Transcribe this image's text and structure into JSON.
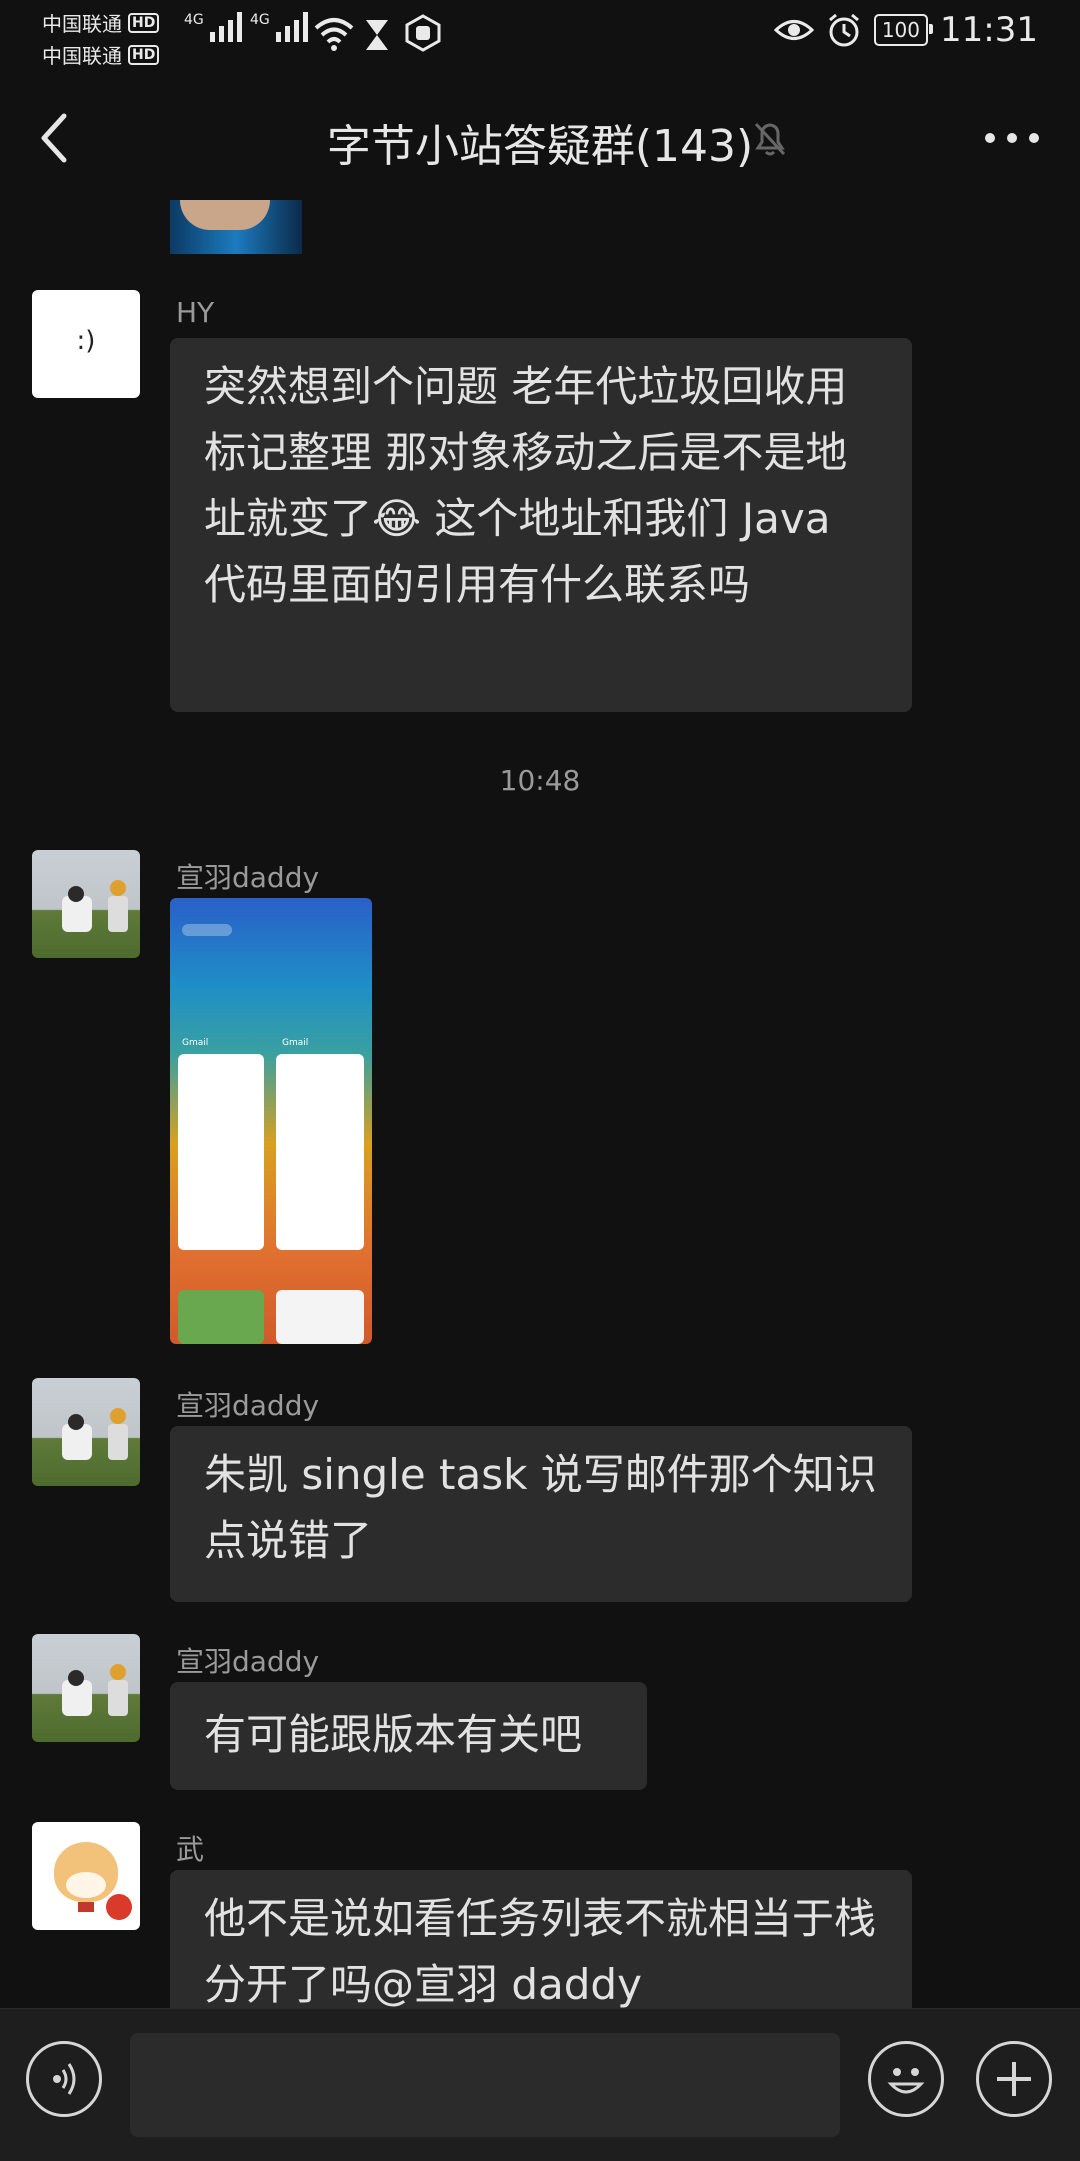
{
  "status_bar": {
    "carrier_1": "中国联通",
    "carrier_2": "中国联通",
    "hd_badge": "HD",
    "net_1": "4G",
    "net_2": "4G",
    "battery": "100",
    "time": "11:31"
  },
  "header": {
    "title": "字节小站答疑群(143)"
  },
  "messages": [
    {
      "sender": "HY",
      "avatar_text": ":)",
      "text": "突然想到个问题 老年代垃圾回收用标记整理 那对象移动之后是不是地址就变了😂 这个地址和我们 Java 代码里面的引用有什么联系吗"
    },
    {
      "timestamp": "10:48"
    },
    {
      "sender": "宣羽daddy",
      "image_labels": [
        "Gmail",
        "Gmail"
      ]
    },
    {
      "sender": "宣羽daddy",
      "text": "朱凯 single task 说写邮件那个知识点说错了"
    },
    {
      "sender": "宣羽daddy",
      "text": "有可能跟版本有关吧"
    },
    {
      "sender": "武",
      "text": "他不是说如看任务列表不就相当于栈分开了吗@宣羽 daddy"
    }
  ],
  "colors": {
    "background": "#111111",
    "bubble": "#2c2c2c",
    "bottom_bar": "#1e1e1e"
  },
  "icons": {
    "back": "chevron-left-icon",
    "mute": "bell-off-icon",
    "more": "more-dots-icon",
    "voice": "voice-icon",
    "emoji": "emoji-icon",
    "plus": "plus-icon"
  }
}
